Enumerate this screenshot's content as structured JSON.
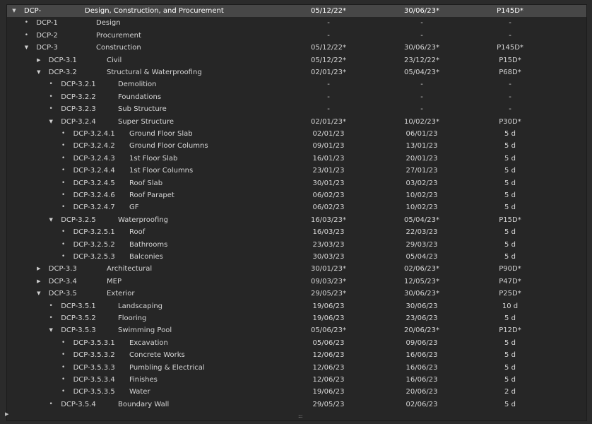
{
  "tree": {
    "rows": [
      {
        "depth": 0,
        "icon": "expanded",
        "id": "DCP-",
        "name": "Design, Construction, and Procurement",
        "start": "05/12/22*",
        "finish": "30/06/23*",
        "duration": "P145D*",
        "selected": true
      },
      {
        "depth": 1,
        "icon": "leaf",
        "id": "DCP-1",
        "name": "Design",
        "start": "-",
        "finish": "-",
        "duration": "-"
      },
      {
        "depth": 1,
        "icon": "leaf",
        "id": "DCP-2",
        "name": "Procurement",
        "start": "-",
        "finish": "-",
        "duration": "-"
      },
      {
        "depth": 1,
        "icon": "expanded",
        "id": "DCP-3",
        "name": "Construction",
        "start": "05/12/22*",
        "finish": "30/06/23*",
        "duration": "P145D*"
      },
      {
        "depth": 2,
        "icon": "collapsed",
        "id": "DCP-3.1",
        "name": "Civil",
        "start": "05/12/22*",
        "finish": "23/12/22*",
        "duration": "P15D*"
      },
      {
        "depth": 2,
        "icon": "expanded",
        "id": "DCP-3.2",
        "name": "Structural & Waterproofing",
        "start": "02/01/23*",
        "finish": "05/04/23*",
        "duration": "P68D*"
      },
      {
        "depth": 3,
        "icon": "leaf",
        "id": "DCP-3.2.1",
        "name": "Demolition",
        "start": "-",
        "finish": "-",
        "duration": "-"
      },
      {
        "depth": 3,
        "icon": "leaf",
        "id": "DCP-3.2.2",
        "name": "Foundations",
        "start": "-",
        "finish": "-",
        "duration": "-"
      },
      {
        "depth": 3,
        "icon": "leaf",
        "id": "DCP-3.2.3",
        "name": "Sub Structure",
        "start": "-",
        "finish": "-",
        "duration": "-"
      },
      {
        "depth": 3,
        "icon": "expanded",
        "id": "DCP-3.2.4",
        "name": "Super Structure",
        "start": "02/01/23*",
        "finish": "10/02/23*",
        "duration": "P30D*"
      },
      {
        "depth": 4,
        "icon": "leaf",
        "id": "DCP-3.2.4.1",
        "name": "Ground Floor Slab",
        "start": "02/01/23",
        "finish": "06/01/23",
        "duration": "5 d"
      },
      {
        "depth": 4,
        "icon": "leaf",
        "id": "DCP-3.2.4.2",
        "name": "Ground Floor Columns",
        "start": "09/01/23",
        "finish": "13/01/23",
        "duration": "5 d"
      },
      {
        "depth": 4,
        "icon": "leaf",
        "id": "DCP-3.2.4.3",
        "name": "1st Floor Slab",
        "start": "16/01/23",
        "finish": "20/01/23",
        "duration": "5 d"
      },
      {
        "depth": 4,
        "icon": "leaf",
        "id": "DCP-3.2.4.4",
        "name": "1st Floor Columns",
        "start": "23/01/23",
        "finish": "27/01/23",
        "duration": "5 d"
      },
      {
        "depth": 4,
        "icon": "leaf",
        "id": "DCP-3.2.4.5",
        "name": "Roof Slab",
        "start": "30/01/23",
        "finish": "03/02/23",
        "duration": "5 d"
      },
      {
        "depth": 4,
        "icon": "leaf",
        "id": "DCP-3.2.4.6",
        "name": "Roof Parapet",
        "start": "06/02/23",
        "finish": "10/02/23",
        "duration": "5 d"
      },
      {
        "depth": 4,
        "icon": "leaf",
        "id": "DCP-3.2.4.7",
        "name": "GF",
        "start": "06/02/23",
        "finish": "10/02/23",
        "duration": "5 d"
      },
      {
        "depth": 3,
        "icon": "expanded",
        "id": "DCP-3.2.5",
        "name": "Waterproofing",
        "start": "16/03/23*",
        "finish": "05/04/23*",
        "duration": "P15D*"
      },
      {
        "depth": 4,
        "icon": "leaf",
        "id": "DCP-3.2.5.1",
        "name": "Roof",
        "start": "16/03/23",
        "finish": "22/03/23",
        "duration": "5 d"
      },
      {
        "depth": 4,
        "icon": "leaf",
        "id": "DCP-3.2.5.2",
        "name": "Bathrooms",
        "start": "23/03/23",
        "finish": "29/03/23",
        "duration": "5 d"
      },
      {
        "depth": 4,
        "icon": "leaf",
        "id": "DCP-3.2.5.3",
        "name": "Balconies",
        "start": "30/03/23",
        "finish": "05/04/23",
        "duration": "5 d"
      },
      {
        "depth": 2,
        "icon": "collapsed",
        "id": "DCP-3.3",
        "name": "Architectural",
        "start": "30/01/23*",
        "finish": "02/06/23*",
        "duration": "P90D*"
      },
      {
        "depth": 2,
        "icon": "collapsed",
        "id": "DCP-3.4",
        "name": "MEP",
        "start": "09/03/23*",
        "finish": "12/05/23*",
        "duration": "P47D*"
      },
      {
        "depth": 2,
        "icon": "expanded",
        "id": "DCP-3.5",
        "name": "Exterior",
        "start": "29/05/23*",
        "finish": "30/06/23*",
        "duration": "P25D*"
      },
      {
        "depth": 3,
        "icon": "leaf",
        "id": "DCP-3.5.1",
        "name": "Landscaping",
        "start": "19/06/23",
        "finish": "30/06/23",
        "duration": "10 d"
      },
      {
        "depth": 3,
        "icon": "leaf",
        "id": "DCP-3.5.2",
        "name": "Flooring",
        "start": "19/06/23",
        "finish": "23/06/23",
        "duration": "5 d"
      },
      {
        "depth": 3,
        "icon": "expanded",
        "id": "DCP-3.5.3",
        "name": "Swimming Pool",
        "start": "05/06/23*",
        "finish": "20/06/23*",
        "duration": "P12D*"
      },
      {
        "depth": 4,
        "icon": "leaf",
        "id": "DCP-3.5.3.1",
        "name": "Excavation",
        "start": "05/06/23",
        "finish": "09/06/23",
        "duration": "5 d"
      },
      {
        "depth": 4,
        "icon": "leaf",
        "id": "DCP-3.5.3.2",
        "name": "Concrete Works",
        "start": "12/06/23",
        "finish": "16/06/23",
        "duration": "5 d"
      },
      {
        "depth": 4,
        "icon": "leaf",
        "id": "DCP-3.5.3.3",
        "name": "Pumbling & Electrical",
        "start": "12/06/23",
        "finish": "16/06/23",
        "duration": "5 d"
      },
      {
        "depth": 4,
        "icon": "leaf",
        "id": "DCP-3.5.3.4",
        "name": "Finishes",
        "start": "12/06/23",
        "finish": "16/06/23",
        "duration": "5 d"
      },
      {
        "depth": 4,
        "icon": "leaf",
        "id": "DCP-3.5.3.5",
        "name": "Water",
        "start": "19/06/23",
        "finish": "20/06/23",
        "duration": "2 d"
      },
      {
        "depth": 3,
        "icon": "leaf",
        "id": "DCP-3.5.4",
        "name": "Boundary Wall",
        "start": "29/05/23",
        "finish": "02/06/23",
        "duration": "5 d"
      }
    ]
  },
  "icons": {
    "expanded": "▼",
    "collapsed": "▶",
    "leaf": "•"
  },
  "footer": {
    "toggle_icon": "▶",
    "grip_icon": "::::"
  },
  "colors": {
    "background": "#262626",
    "selected_row": "#474747",
    "text": "#d6d6d6"
  }
}
